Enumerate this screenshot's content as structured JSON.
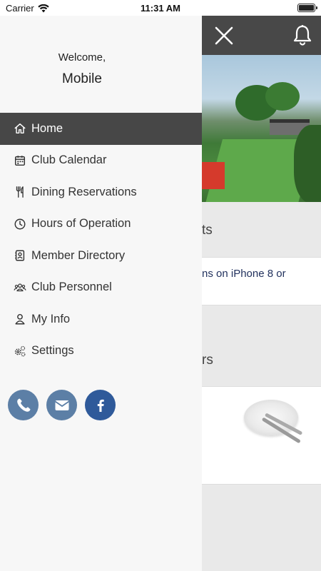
{
  "status_bar": {
    "carrier": "Carrier",
    "time": "11:31 AM"
  },
  "colors": {
    "header_bg": "#484848",
    "active_item_bg": "#474747",
    "social_blue": "#5c7fa6",
    "facebook_blue": "#2f5a9a"
  },
  "header": {
    "close_icon": "close-icon",
    "bell_icon": "bell-icon"
  },
  "drawer": {
    "welcome": "Welcome,",
    "user_name": "Mobile",
    "items": [
      {
        "label": "Home",
        "icon": "home-icon",
        "active": true
      },
      {
        "label": "Club Calendar",
        "icon": "calendar-icon",
        "active": false
      },
      {
        "label": "Dining Reservations",
        "icon": "utensils-icon",
        "active": false
      },
      {
        "label": "Hours of Operation",
        "icon": "clock-icon",
        "active": false
      },
      {
        "label": "Member Directory",
        "icon": "address-book-icon",
        "active": false
      },
      {
        "label": "Club Personnel",
        "icon": "users-icon",
        "active": false
      },
      {
        "label": "My Info",
        "icon": "user-icon",
        "active": false
      },
      {
        "label": "Settings",
        "icon": "gears-icon",
        "active": false
      }
    ],
    "social": [
      "phone-icon",
      "email-icon",
      "facebook-icon"
    ]
  },
  "background": {
    "section1_fragment": "ts",
    "row1_fragment_line1": "ns on iPhone 8 or",
    "section2_fragment": "rs"
  }
}
